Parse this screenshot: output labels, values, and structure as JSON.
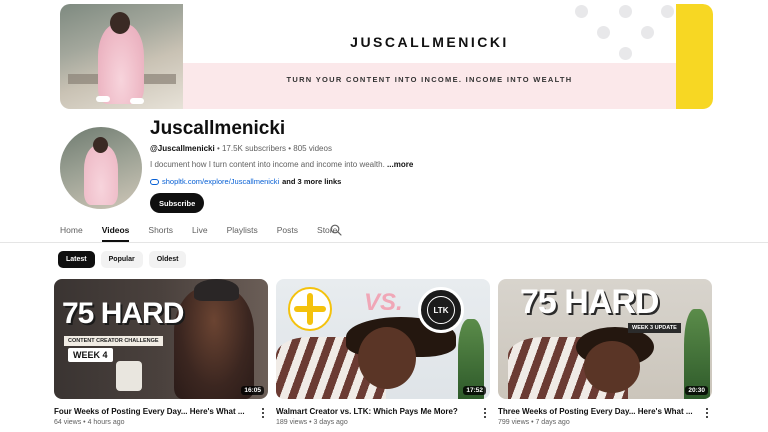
{
  "banner": {
    "title": "JUSCALLMENICKI",
    "tagline": "TURN YOUR CONTENT INTO INCOME. INCOME INTO WEALTH"
  },
  "channel": {
    "name": "Juscallmenicki",
    "handle": "@Juscallmenicki",
    "stats": " • 17.5K subscribers • 805 videos",
    "description": "I document how I turn content into income and income into wealth.",
    "more_label": "...more",
    "link_url": "shopltk.com/explore/Juscallmenicki",
    "link_rest": "and 3 more links",
    "subscribe_label": "Subscribe"
  },
  "tabs": [
    {
      "label": "Home"
    },
    {
      "label": "Videos"
    },
    {
      "label": "Shorts"
    },
    {
      "label": "Live"
    },
    {
      "label": "Playlists"
    },
    {
      "label": "Posts"
    },
    {
      "label": "Store"
    }
  ],
  "chips": [
    {
      "label": "Latest"
    },
    {
      "label": "Popular"
    },
    {
      "label": "Oldest"
    }
  ],
  "videos": [
    {
      "title": "Four Weeks of Posting Every Day... Here's What ...",
      "meta": "64 views • 4 hours ago",
      "duration": "16:05",
      "thumb_text": "75 HARD",
      "thumb_strip": "CONTENT CREATOR CHALLENGE",
      "thumb_week": "WEEK 4"
    },
    {
      "title": "Walmart Creator vs. LTK: Which Pays Me More?",
      "meta": "189 views • 3 days ago",
      "duration": "17:52",
      "thumb_vs": "VS.",
      "thumb_ltk": "LTK"
    },
    {
      "title": "Three Weeks of Posting Every Day... Here's What ...",
      "meta": "799 views • 7 days ago",
      "duration": "20:30",
      "thumb_text": "75 HARD",
      "thumb_week": "WEEK 3 UPDATE"
    }
  ],
  "colors": {
    "banner_yellow": "#f7d723",
    "banner_pink": "#fbe8ea",
    "link_blue": "#065fd4",
    "text_primary": "#0f0f0f",
    "text_secondary": "#606060"
  }
}
